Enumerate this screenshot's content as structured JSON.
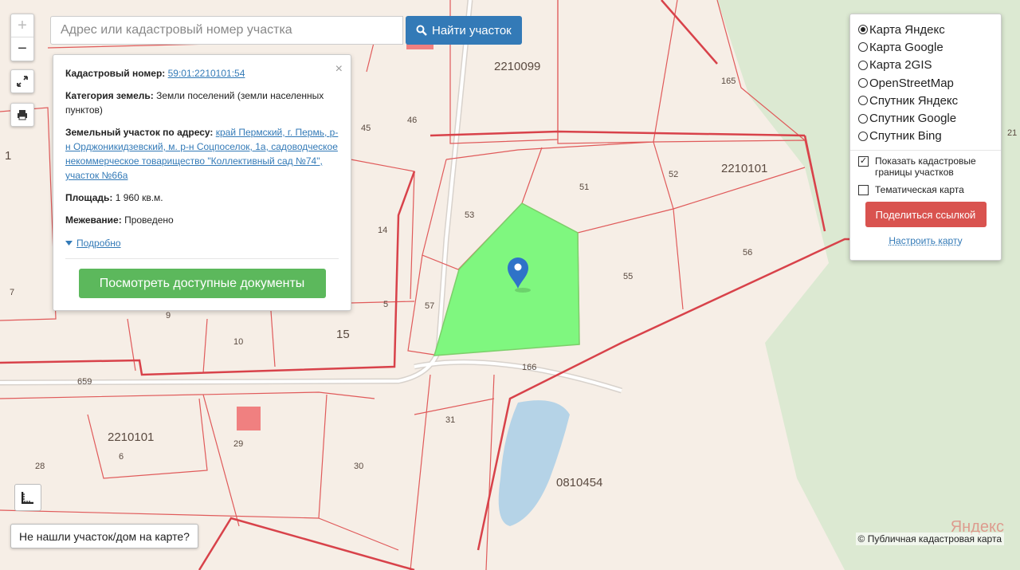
{
  "map": {
    "parcel_labels": [
      "2210099",
      "2210101",
      "52",
      "51",
      "53",
      "55",
      "56",
      "57",
      "165",
      "659",
      "45",
      "46",
      "14",
      "5",
      "15",
      "10",
      "9",
      "7",
      "1",
      "166",
      "31",
      "30",
      "29",
      "28",
      "6",
      "2210101",
      "0810454",
      "21"
    ],
    "selected_parcel_color": "#7ff77f",
    "parcel_line_color": "#e05a5a",
    "water_color": "#b5d3e7",
    "forest_color": "#dce9d2"
  },
  "controls": {
    "zoom_in": "+",
    "zoom_out": "−"
  },
  "search": {
    "placeholder": "Адрес или кадастровый номер участка",
    "button_label": "Найти участок"
  },
  "popup": {
    "cadastral_label": "Кадастровый номер:",
    "cadastral_value": "59:01:2210101:54",
    "category_label": "Категория земель:",
    "category_value": "Земли поселений (земли населенных пунктов)",
    "address_label": "Земельный участок по адресу:",
    "address_value": "край Пермский, г. Пермь, р-н Орджоникидзевский, м. р-н Соцпоселок, 1а, садоводческое некоммерческое товарищество \"Коллективный сад №74\", участок №66а",
    "area_label": "Площадь:",
    "area_value": "1 960 кв.м.",
    "survey_label": "Межевание:",
    "survey_value": "Проведено",
    "more_link": "Подробно",
    "docs_button": "Посмотреть доступные документы",
    "close": "×"
  },
  "layers": {
    "options": [
      {
        "label": "Карта Яндекс",
        "selected": true
      },
      {
        "label": "Карта Google",
        "selected": false
      },
      {
        "label": "Карта 2GIS",
        "selected": false
      },
      {
        "label": "OpenStreetMap",
        "selected": false
      },
      {
        "label": "Спутник Яндекс",
        "selected": false
      },
      {
        "label": "Спутник Google",
        "selected": false
      },
      {
        "label": "Спутник Bing",
        "selected": false
      }
    ],
    "show_borders_label": "Показать кадастровые границы участков",
    "show_borders_checked": true,
    "thematic_label": "Тематическая карта",
    "thematic_checked": false,
    "share_button": "Поделиться ссылкой",
    "configure_link": "Настроить карту"
  },
  "footer": {
    "not_found": "Не нашли участок/дом на карте?",
    "copyright": "© Публичная кадастровая карта",
    "yandex": "Яндекс"
  }
}
